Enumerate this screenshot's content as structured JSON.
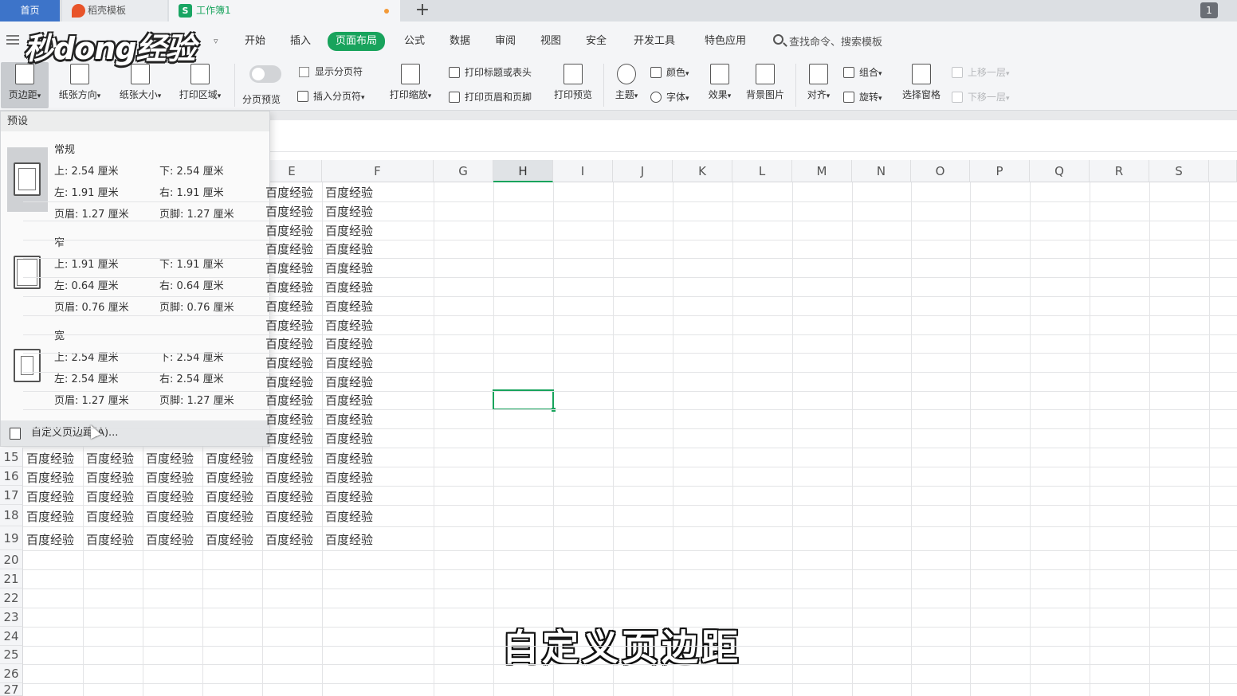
{
  "titlebar": {
    "home_tab": "首页",
    "templates_tab": "稻壳模板",
    "workbook_tab": "工作簿1",
    "new_tab": "+",
    "window_badge": "1"
  },
  "watermark": {
    "logo": "秒dong经验"
  },
  "menu": {
    "items": [
      "开始",
      "插入",
      "页面布局",
      "公式",
      "数据",
      "审阅",
      "视图",
      "安全",
      "开发工具",
      "特色应用"
    ],
    "active": "页面布局",
    "search": "查找命令、搜索模板",
    "more_arrow": "▿"
  },
  "ribbon": {
    "margins": "页边距",
    "orientation": "纸张方向",
    "size": "纸张大小",
    "print_area": "打印区域",
    "page_break_preview": "分页预览",
    "show_page_breaks": "显示分页符",
    "insert_page_break": "插入分页符",
    "print_scaling": "打印缩放",
    "print_titles": "打印标题或表头",
    "header_footer": "打印页眉和页脚",
    "print_preview": "打印预览",
    "theme": "主题",
    "colors": "颜色",
    "fonts": "字体",
    "effects": "效果",
    "background": "背景图片",
    "align": "对齐",
    "group": "组合",
    "rotate": "旋转",
    "selection_pane": "选择窗格",
    "bring_forward": "上移一层",
    "send_backward": "下移一层",
    "dropdown_caret": "▾"
  },
  "grid": {
    "columns": [
      "E",
      "F",
      "G",
      "H",
      "I",
      "J",
      "K",
      "L",
      "M",
      "N",
      "O",
      "P",
      "Q",
      "R",
      "S"
    ],
    "active_column": "H",
    "row_numbers": [
      "15",
      "16",
      "17",
      "18",
      "19",
      "20",
      "21",
      "22",
      "23",
      "24",
      "25",
      "26",
      "27"
    ],
    "cell_text": "百度经验",
    "partial_cell_text": "百度经验"
  },
  "margins_dropdown": {
    "header": "预设",
    "presets": [
      {
        "name": "常规",
        "top": "上: 2.54 厘米",
        "bottom": "下: 2.54 厘米",
        "left": "左: 1.91 厘米",
        "right": "右: 1.91 厘米",
        "header": "页眉: 1.27 厘米",
        "footer": "页脚: 1.27 厘米"
      },
      {
        "name": "窄",
        "top": "上: 1.91 厘米",
        "bottom": "下: 1.91 厘米",
        "left": "左: 0.64 厘米",
        "right": "右: 0.64 厘米",
        "header": "页眉: 0.76 厘米",
        "footer": "页脚: 0.76 厘米"
      },
      {
        "name": "宽",
        "top": "上: 2.54 厘米",
        "bottom": "下: 2.54 厘米",
        "left": "左: 2.54 厘米",
        "right": "右: 2.54 厘米",
        "header": "页眉: 1.27 厘米",
        "footer": "页脚: 1.27 厘米"
      }
    ],
    "custom": "自定义页边距(A)..."
  },
  "subtitle": "自定义页边距",
  "colors": {
    "accent": "#18a35c",
    "home_tab": "#3d74c9"
  }
}
